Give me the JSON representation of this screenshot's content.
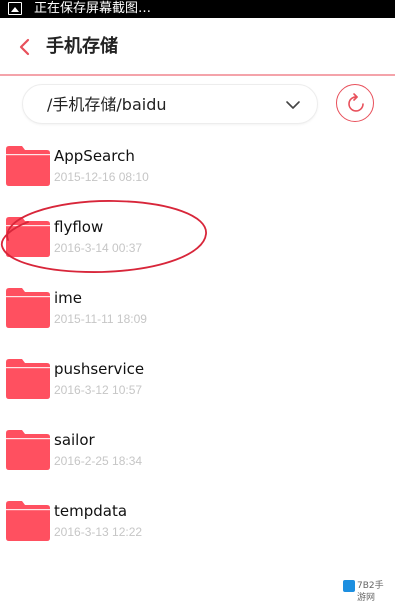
{
  "status_bar": {
    "text": "正在保存屏幕截图…",
    "icon": "image-icon"
  },
  "header": {
    "title": "手机存储",
    "back_icon": "chevron-left-icon"
  },
  "path_bar": {
    "path": "/手机存储/baidu",
    "dropdown_icon": "chevron-down-icon"
  },
  "refresh": {
    "icon": "refresh-icon",
    "accent": "#e8505b"
  },
  "folder_color": "#ff5060",
  "folders": [
    {
      "name": "AppSearch",
      "date": "2015-12-16 08:10"
    },
    {
      "name": "flyflow",
      "date": "2016-3-14 00:37"
    },
    {
      "name": "ime",
      "date": "2015-11-11 18:09"
    },
    {
      "name": "pushservice",
      "date": "2016-3-12 10:57"
    },
    {
      "name": "sailor",
      "date": "2016-2-25 18:34"
    },
    {
      "name": "tempdata",
      "date": "2016-3-13 12:22"
    }
  ],
  "watermark": {
    "text": "7B2手游网"
  }
}
